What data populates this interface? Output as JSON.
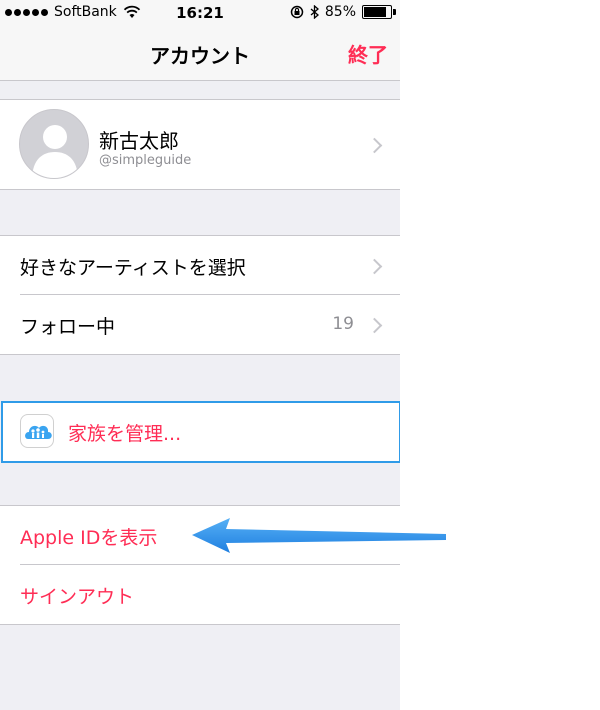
{
  "status_bar": {
    "carrier": "SoftBank",
    "time": "16:21",
    "battery_percent": "85%",
    "battery_level": 0.85,
    "signal_dots": 5
  },
  "nav": {
    "title": "アカウント",
    "done_label": "終了"
  },
  "profile": {
    "name": "新古太郎",
    "handle": "@simpleguide"
  },
  "music": {
    "items": [
      {
        "label": "好きなアーティストを選択",
        "value": ""
      },
      {
        "label": "フォロー中",
        "value": "19"
      }
    ]
  },
  "family": {
    "label": "家族を管理..."
  },
  "account_actions": {
    "items": [
      {
        "label": "Apple IDを表示"
      },
      {
        "label": "サインアウト"
      }
    ]
  },
  "colors": {
    "accent": "#ff2d55",
    "highlight_border": "#2f9be8",
    "arrow": "#2d8de8"
  }
}
